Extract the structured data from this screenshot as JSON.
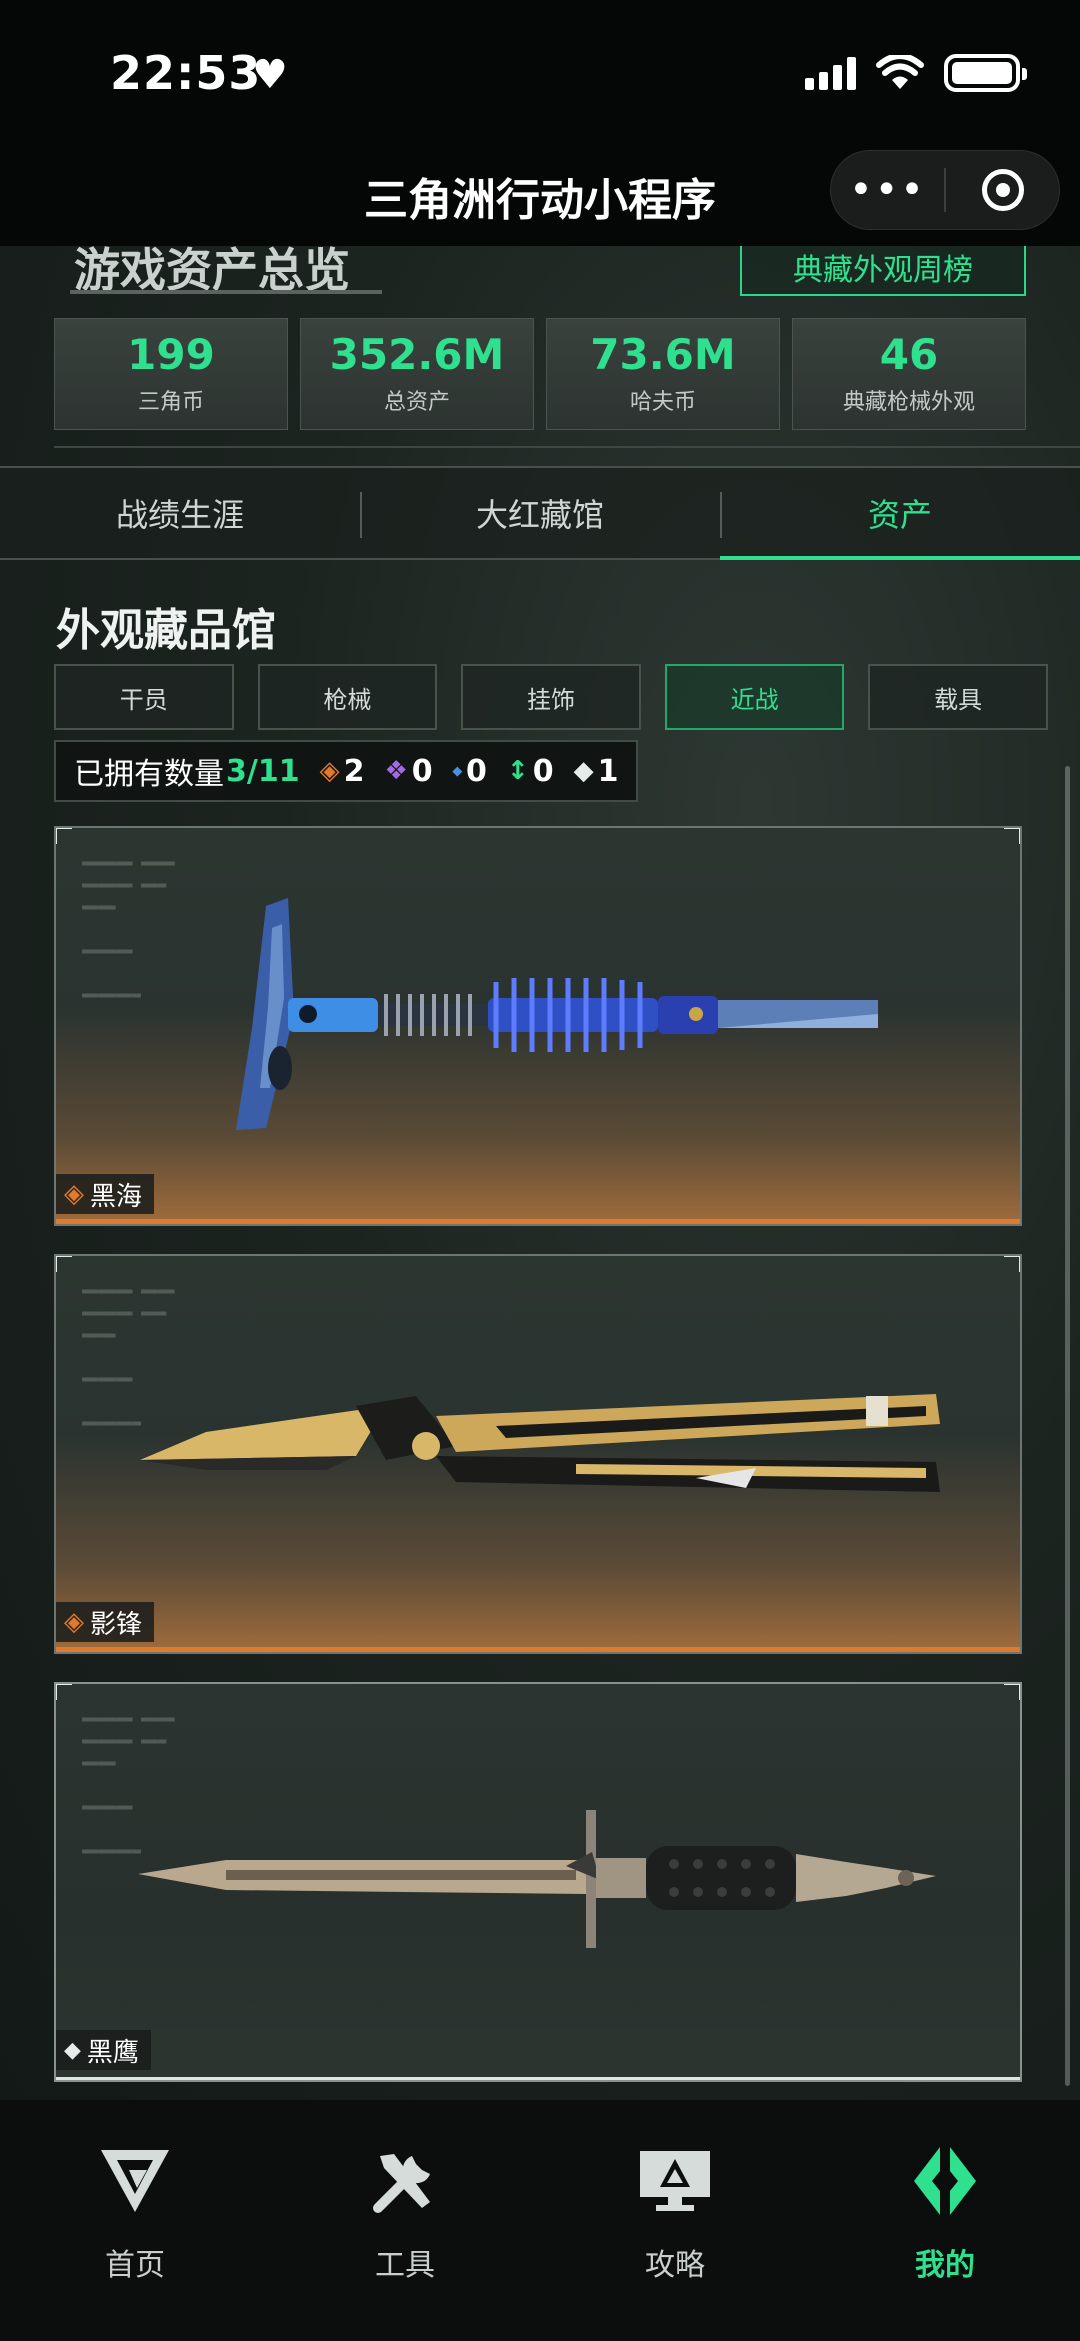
{
  "status_bar": {
    "time": "22:53",
    "heart": "♥"
  },
  "nav": {
    "title": "三角洲行动小程序",
    "more": "•••"
  },
  "overview": {
    "title": "游戏资产总览",
    "weekly_button": "典藏外观周榜",
    "stats": [
      {
        "value": "199",
        "label": "三角币"
      },
      {
        "value": "352.6M",
        "label": "总资产"
      },
      {
        "value": "73.6M",
        "label": "哈夫币"
      },
      {
        "value": "46",
        "label": "典藏枪械外观"
      }
    ]
  },
  "tabs": [
    {
      "label": "战绩生涯",
      "active": false
    },
    {
      "label": "大红藏馆",
      "active": false
    },
    {
      "label": "资产",
      "active": true
    }
  ],
  "gallery": {
    "title": "外观藏品馆",
    "filters": [
      {
        "label": "干员",
        "active": false
      },
      {
        "label": "枪械",
        "active": false
      },
      {
        "label": "挂饰",
        "active": false
      },
      {
        "label": "近战",
        "active": true
      },
      {
        "label": "载具",
        "active": false
      }
    ],
    "owned_label": "已拥有数量",
    "owned_count": "3/11",
    "rarity_counts": [
      {
        "icon": "orange-diamond-icon",
        "color": "#e07a2c",
        "count": "2"
      },
      {
        "icon": "purple-diamond-icon",
        "color": "#a46be0",
        "count": "0"
      },
      {
        "icon": "blue-diamond-icon",
        "color": "#4a8fe0",
        "count": "0"
      },
      {
        "icon": "green-arrows-icon",
        "color": "#2fe08f",
        "count": "0"
      },
      {
        "icon": "white-diamond-icon",
        "color": "#e6ecea",
        "count": "1"
      }
    ],
    "items": [
      {
        "name": "黑海",
        "rarity": "orange",
        "weapon": "axe"
      },
      {
        "name": "影锋",
        "rarity": "orange",
        "weapon": "butterfly-knife"
      },
      {
        "name": "黑鹰",
        "rarity": "white",
        "weapon": "bayonet"
      }
    ]
  },
  "bottom_nav": [
    {
      "label": "首页",
      "icon": "home-logo-icon",
      "active": false
    },
    {
      "label": "工具",
      "icon": "tools-icon",
      "active": false
    },
    {
      "label": "攻略",
      "icon": "guide-monitor-icon",
      "active": false
    },
    {
      "label": "我的",
      "icon": "profile-logo-icon",
      "active": true
    }
  ],
  "colors": {
    "accent": "#2fe08f",
    "gold_rarity": "#e07a2c",
    "background": "#121816"
  }
}
